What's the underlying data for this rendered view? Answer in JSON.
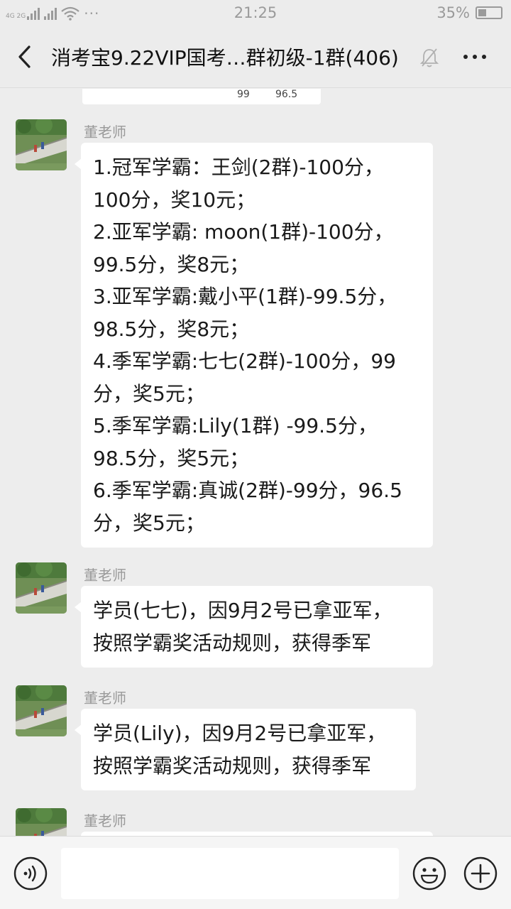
{
  "status_bar": {
    "signal_text": "4G 2G",
    "dots": "···",
    "time": "21:25",
    "battery": "35%",
    "battery_level": 0.35
  },
  "header": {
    "title": "消考宝9.22VIP国考…群初级-1群(406)"
  },
  "chat": {
    "snippet_values": [
      "99",
      "96.5"
    ],
    "messages": [
      {
        "sender": "董老师",
        "lines": [
          "1.冠军学霸：王剑(2群)-100分，",
          "100分，奖10元；",
          "2.亚军学霸: moon(1群)-100分，",
          "99.5分，奖8元；",
          "3.亚军学霸:戴小平(1群)-99.5分，",
          "98.5分，奖8元；",
          "4.季军学霸:七七(2群)-100分，99",
          "分，奖5元；",
          "5.季军学霸:Lily(1群) -99.5分，",
          "98.5分，奖5元；",
          "6.季军学霸:真诚(2群)-99分，96.5",
          "分，奖5元；"
        ]
      },
      {
        "sender": "董老师",
        "lines": [
          "学员(七七)，因9月2号已拿亚军，",
          "按照学霸奖活动规则，获得季军"
        ]
      },
      {
        "sender": "董老师",
        "lines": [
          "学员(Lily)，因9月2号已拿亚军，",
          "按照学霸奖活动规则，获得季军"
        ]
      },
      {
        "sender": "董老师",
        "lines": []
      }
    ]
  },
  "input_bar": {
    "value": "",
    "placeholder": ""
  },
  "colors": {
    "background": "#ededed",
    "bubble": "#ffffff",
    "sender": "#999999"
  }
}
